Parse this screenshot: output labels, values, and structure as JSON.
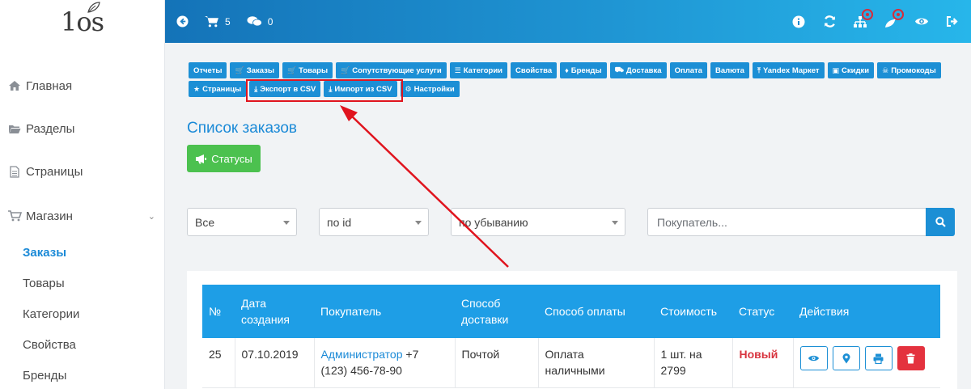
{
  "logo": {
    "text": "1os"
  },
  "sidebar": {
    "items": [
      {
        "label": "Главная",
        "icon": "home-icon"
      },
      {
        "label": "Разделы",
        "icon": "folder-icon"
      },
      {
        "label": "Страницы",
        "icon": "file-icon"
      },
      {
        "label": "Магазин",
        "icon": "cart-icon"
      }
    ],
    "sub_items": [
      "Заказы",
      "Товары",
      "Категории",
      "Свойства",
      "Бренды"
    ]
  },
  "header": {
    "cart_count": "5",
    "messages_count": "0",
    "icons": [
      "back-icon",
      "cart-icon",
      "comments-icon",
      "info-icon",
      "refresh-icon",
      "sitemap-icon",
      "plugin-icon",
      "eye-icon",
      "logout-icon"
    ]
  },
  "tabs": [
    {
      "label": "Отчеты",
      "icon": ""
    },
    {
      "label": "Заказы",
      "icon": "cart-icon"
    },
    {
      "label": "Товары",
      "icon": "cart-icon"
    },
    {
      "label": "Сопутствующие услуги",
      "icon": "cart-icon"
    },
    {
      "label": "Категории",
      "icon": "list-icon"
    },
    {
      "label": "Свойства",
      "icon": ""
    },
    {
      "label": "Бренды",
      "icon": "bell-icon"
    },
    {
      "label": "Доставка",
      "icon": "truck-icon"
    },
    {
      "label": "Оплата",
      "icon": ""
    },
    {
      "label": "Валюта",
      "icon": ""
    },
    {
      "label": "Yandex Маркет",
      "icon": "upload-icon"
    },
    {
      "label": "Скидки",
      "icon": "gift-icon"
    },
    {
      "label": "Промокоды",
      "icon": "trophy-icon"
    },
    {
      "label": "Страницы",
      "icon": "star-icon"
    },
    {
      "label": "Экспорт в CSV",
      "icon": "download-icon"
    },
    {
      "label": "Импорт из CSV",
      "icon": "download-icon"
    },
    {
      "label": "Настройки",
      "icon": "gear-icon"
    }
  ],
  "page": {
    "title": "Список заказов",
    "status_button": "Статусы"
  },
  "filters": {
    "type": "Все",
    "sort_field": "по id",
    "sort_dir": "по убыванию",
    "search_placeholder": "Покупатель..."
  },
  "table": {
    "headers": [
      "№",
      "Дата создания",
      "Покупатель",
      "Способ доставки",
      "Способ оплаты",
      "Стоимость",
      "Статус",
      "Действия"
    ],
    "rows": [
      {
        "id": "25",
        "date": "07.10.2019",
        "customer_name": "Администратор",
        "customer_phone": "+7 (123) 456-78-90",
        "delivery": "Почтой",
        "payment": "Оплата наличными",
        "cost": "1 шт. на 2799",
        "status": "Новый"
      }
    ]
  },
  "colors": {
    "accent": "#1c8fd5",
    "success": "#4cc14f",
    "danger": "#e4323e",
    "highlight": "#e0141e"
  }
}
